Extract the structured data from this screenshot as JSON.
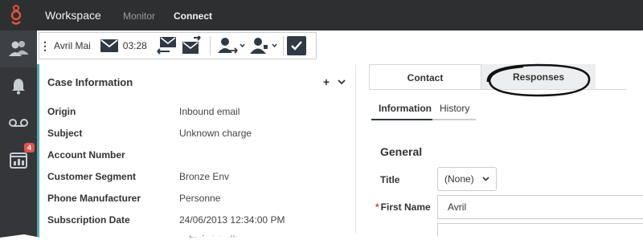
{
  "topbar": {
    "app_title": "Workspace",
    "nav": [
      {
        "label": "Monitor"
      },
      {
        "label": "Connect"
      }
    ],
    "logo_icon": "genesys-logo-icon"
  },
  "rail": {
    "items": [
      {
        "icon": "contacts-icon"
      },
      {
        "icon": "bell-icon"
      },
      {
        "icon": "voicemail-icon"
      },
      {
        "icon": "statistics-icon",
        "badge": "4"
      }
    ]
  },
  "interaction_bar": {
    "party_name": "Avril Mai",
    "timer": "03:28",
    "icons": [
      "email-icon",
      "reply-email-icon",
      "forward-email-icon",
      "transfer-icon",
      "consult-icon",
      "mark-done-icon"
    ]
  },
  "case_info": {
    "title": "Case Information",
    "rows": [
      {
        "label": "Origin",
        "value": "Inbound email"
      },
      {
        "label": "Subject",
        "value": "Unknown charge"
      },
      {
        "label": "Account Number",
        "value": ""
      },
      {
        "label": "Customer Segment",
        "value": "Bronze Env"
      },
      {
        "label": "Phone Manufacturer",
        "value": "Personne"
      },
      {
        "label": "Subscription Date",
        "value": "24/06/2013 12:34:00 PM"
      }
    ],
    "truncated_text": "href=\"http://mobile.fre..."
  },
  "right_panel": {
    "tabs": [
      {
        "label": "Contact"
      },
      {
        "label": "Responses"
      }
    ],
    "subtabs": [
      {
        "label": "Information"
      },
      {
        "label": "History"
      }
    ],
    "section_title": "General",
    "title_field": {
      "label": "Title",
      "value": "(None)"
    },
    "first_name_field": {
      "label": "First Name",
      "value": "Avril",
      "required": "*"
    }
  },
  "colors": {
    "topbar": "#2d2f31",
    "rail": "#34363a",
    "accent_logo": "#e8503e",
    "panel_accent": "#58a6b5",
    "badge": "#e0544b"
  }
}
